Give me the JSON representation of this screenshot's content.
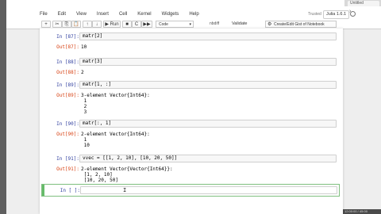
{
  "browser": {
    "tab_label": "Untitled"
  },
  "menu": [
    "File",
    "Edit",
    "View",
    "Insert",
    "Cell",
    "Kernel",
    "Widgets",
    "Help"
  ],
  "status": {
    "trusted": "Trusted",
    "kernel": "Julia 1.6.1"
  },
  "toolbar": {
    "buttons": [
      "+",
      "✂",
      "⎘",
      "📋",
      "↑",
      "↓"
    ],
    "run_label": "▶ Run",
    "stop": "■",
    "restart": "C",
    "fastforward": "▶▶",
    "cell_type": "Code",
    "nbdiff": "nbdiff",
    "validate": "Validate",
    "create_gist": "Create/Edit Gist of Notebook"
  },
  "cells": [
    {
      "in_prompt": "In [87]:",
      "code": "matr[2]",
      "out_prompt": "Out[87]:",
      "output": "10"
    },
    {
      "in_prompt": "In [88]:",
      "code": "matr[3]",
      "out_prompt": "Out[88]:",
      "output": "2"
    },
    {
      "in_prompt": "In [89]:",
      "code": "matr[1, :]",
      "out_prompt": "Out[89]:",
      "output": "3-element Vector{Int64}:\n 1\n 2\n 3"
    },
    {
      "in_prompt": "In [90]:",
      "code": "matr[:, 1]",
      "out_prompt": "Out[90]:",
      "output": "2-element Vector{Int64}:\n 1\n 10"
    },
    {
      "in_prompt": "In [91]:",
      "code": "vvec = [[1, 2, 10], [10, 20, 50]]",
      "out_prompt": "Out[91]:",
      "output": "2-element Vector{Vector{Int64}}:\n [1, 2, 10]\n [10, 20, 50]"
    }
  ],
  "active_cell": {
    "in_prompt": "In [ ]:",
    "code": ""
  },
  "footer": {
    "clock": "12:00:00 / 45:00"
  }
}
